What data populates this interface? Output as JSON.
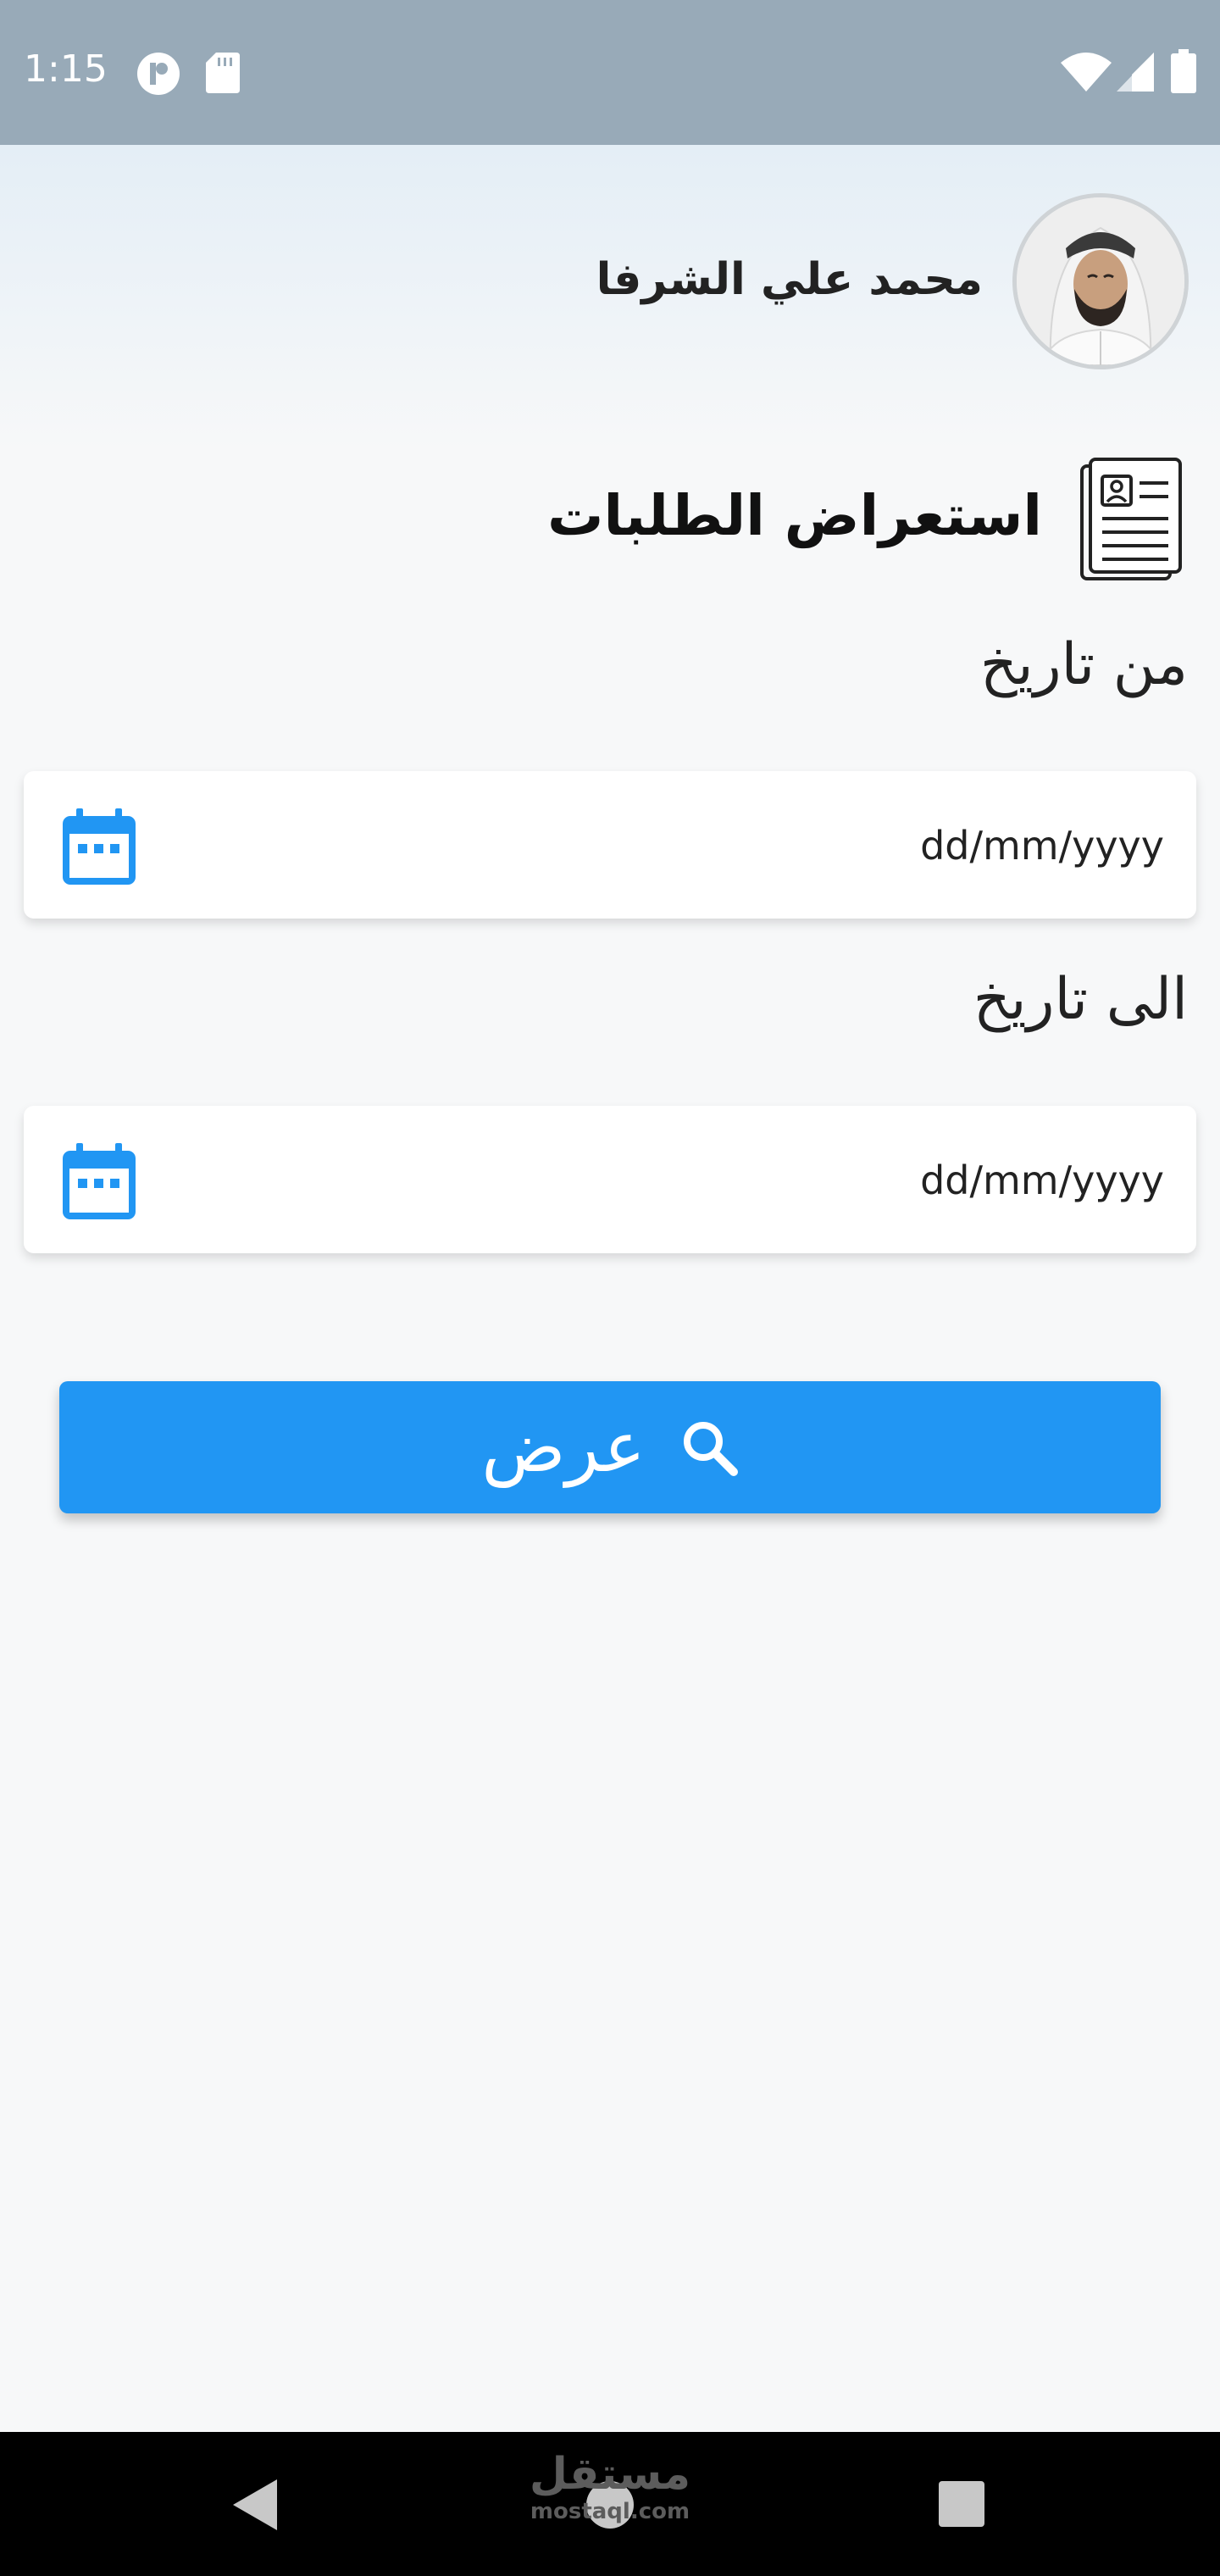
{
  "status_bar": {
    "time": "1:15",
    "icons": [
      "notification-app-icon",
      "sd-card-icon",
      "wifi-icon",
      "signal-icon",
      "battery-icon"
    ]
  },
  "profile": {
    "name": "محمد علي الشرفا",
    "avatar_icon": "user-photo"
  },
  "page": {
    "title": "استعراض الطلبات",
    "title_icon": "document-list-icon"
  },
  "form": {
    "from_date": {
      "label": "من تاريخ",
      "placeholder": "dd/mm/yyyy",
      "value": ""
    },
    "to_date": {
      "label": "الى تاريخ",
      "placeholder": "dd/mm/yyyy",
      "value": ""
    },
    "submit": {
      "label": "عرض",
      "icon": "search-icon"
    }
  },
  "nav_bar": {
    "buttons": [
      "back-icon",
      "home-icon",
      "recents-icon"
    ]
  },
  "watermark": {
    "arabic": "مستقل",
    "latin": "mostaql.com"
  },
  "colors": {
    "accent": "#2196f3",
    "status_bar": "#98aab8",
    "background": "#f7f8f9",
    "nav_bar": "#000000"
  }
}
